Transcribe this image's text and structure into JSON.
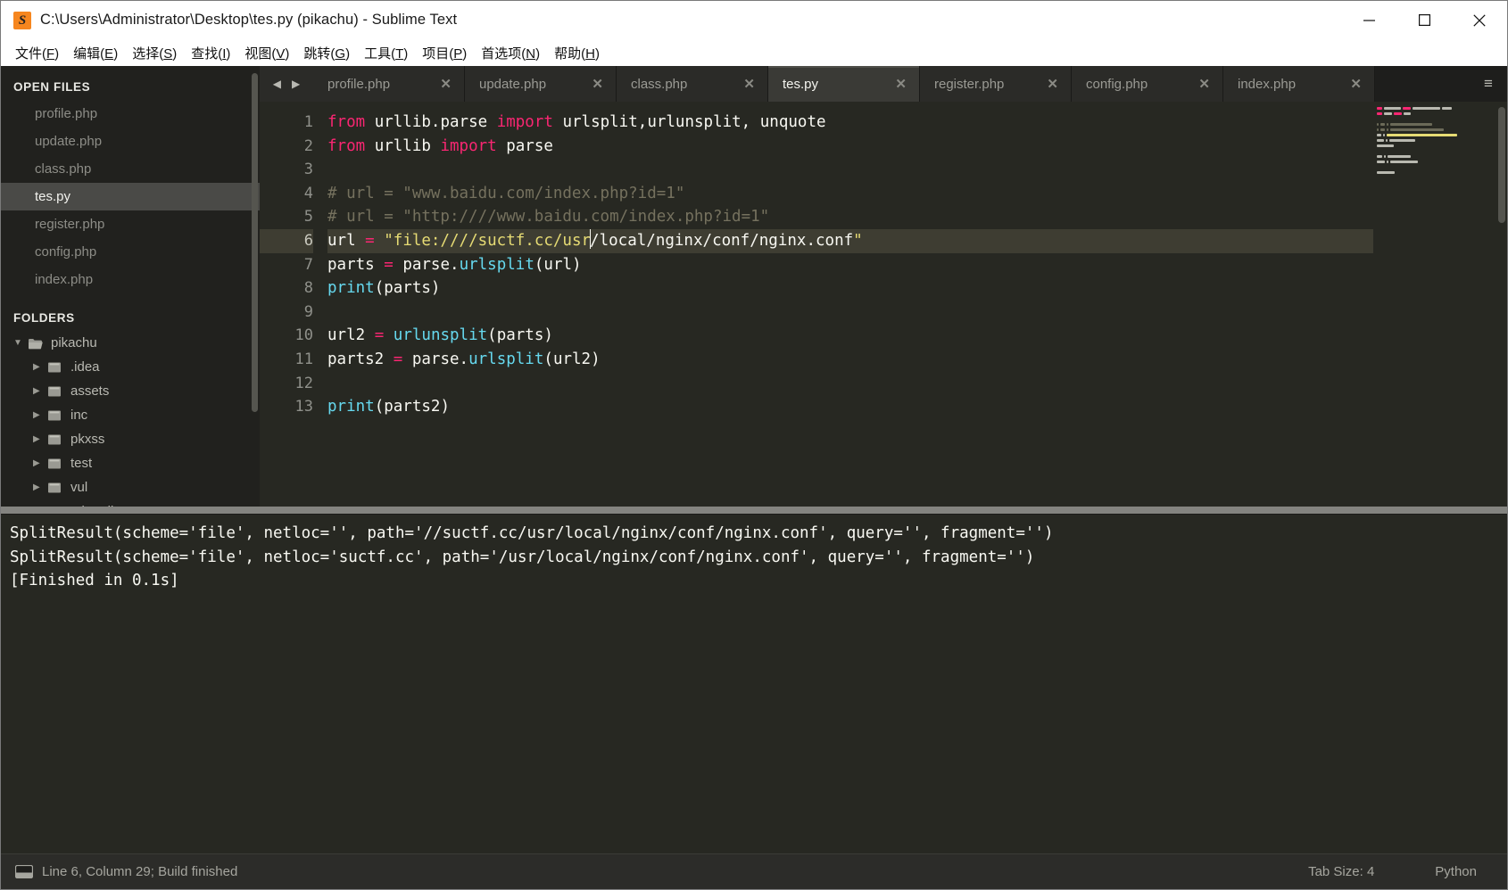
{
  "window": {
    "title": "C:\\Users\\Administrator\\Desktop\\tes.py (pikachu) - Sublime Text",
    "app_icon": "sublime-text-icon",
    "minimize_label": "—",
    "maximize_label": "□",
    "close_label": "×"
  },
  "menubar": {
    "items": [
      {
        "text": "文件",
        "accel": "F"
      },
      {
        "text": "编辑",
        "accel": "E"
      },
      {
        "text": "选择",
        "accel": "S"
      },
      {
        "text": "查找",
        "accel": "I"
      },
      {
        "text": "视图",
        "accel": "V"
      },
      {
        "text": "跳转",
        "accel": "G"
      },
      {
        "text": "工具",
        "accel": "T"
      },
      {
        "text": "项目",
        "accel": "P"
      },
      {
        "text": "首选项",
        "accel": "N"
      },
      {
        "text": "帮助",
        "accel": "H"
      }
    ]
  },
  "sidebar": {
    "open_files_header": "OPEN FILES",
    "open_files": [
      {
        "label": "profile.php",
        "active": false
      },
      {
        "label": "update.php",
        "active": false
      },
      {
        "label": "class.php",
        "active": false
      },
      {
        "label": "tes.py",
        "active": true
      },
      {
        "label": "register.php",
        "active": false
      },
      {
        "label": "config.php",
        "active": false
      },
      {
        "label": "index.php",
        "active": false
      }
    ],
    "folders_header": "FOLDERS",
    "tree": [
      {
        "label": "pikachu",
        "depth": 0,
        "state": "open",
        "type": "folder"
      },
      {
        "label": ".idea",
        "depth": 1,
        "state": "closed",
        "type": "folder"
      },
      {
        "label": "assets",
        "depth": 1,
        "state": "closed",
        "type": "folder"
      },
      {
        "label": "inc",
        "depth": 1,
        "state": "closed",
        "type": "folder"
      },
      {
        "label": "pkxss",
        "depth": 1,
        "state": "closed",
        "type": "folder"
      },
      {
        "label": "test",
        "depth": 1,
        "state": "closed",
        "type": "folder"
      },
      {
        "label": "vul",
        "depth": 1,
        "state": "closed",
        "type": "folder"
      },
      {
        "label": ".gitattributes",
        "depth": 1,
        "state": "none",
        "type": "file"
      }
    ]
  },
  "tabs": {
    "prev_label": "◀",
    "next_label": "▶",
    "menu_label": "≡",
    "close_label": "✕",
    "items": [
      {
        "label": "profile.php",
        "active": false
      },
      {
        "label": "update.php",
        "active": false
      },
      {
        "label": "class.php",
        "active": false
      },
      {
        "label": "tes.py",
        "active": true
      },
      {
        "label": "register.php",
        "active": false
      },
      {
        "label": "config.php",
        "active": false
      },
      {
        "label": "index.php",
        "active": false
      }
    ]
  },
  "editor": {
    "line_numbers": [
      "1",
      "2",
      "3",
      "4",
      "5",
      "6",
      "7",
      "8",
      "9",
      "10",
      "11",
      "12",
      "13"
    ],
    "current_line": 6,
    "lines": [
      "from urllib.parse import urlsplit,urlunsplit, unquote",
      "from urllib import parse",
      "",
      "# url = \"www.baidu.com/index.php?id=1\"",
      "# url = \"http:////www.baidu.com/index.php?id=1\"",
      "url = \"file:////suctf.cc/usr/local/nginx/conf/nginx.conf\"",
      "parts = parse.urlsplit(url)",
      "print(parts)",
      "",
      "url2 = urlunsplit(parts)",
      "parts2 = parse.urlsplit(url2)",
      "",
      "print(parts2)"
    ]
  },
  "console": {
    "lines": [
      "SplitResult(scheme='file', netloc='', path='//suctf.cc/usr/local/nginx/conf/nginx.conf', query='', fragment='')",
      "SplitResult(scheme='file', netloc='suctf.cc', path='/usr/local/nginx/conf/nginx.conf', query='', fragment='')",
      "[Finished in 0.1s]"
    ]
  },
  "statusbar": {
    "icon": "console-icon",
    "left_text": "Line 6, Column 29; Build finished",
    "tab_size": "Tab Size: 4",
    "syntax": "Python"
  },
  "colors": {
    "background": "#272822",
    "sidebar": "#21211e",
    "keyword": "#f92672",
    "function": "#66d9ef",
    "string": "#e6db74",
    "comment": "#75715e",
    "plain": "#f8f8f2",
    "accent": "#f6861f"
  }
}
